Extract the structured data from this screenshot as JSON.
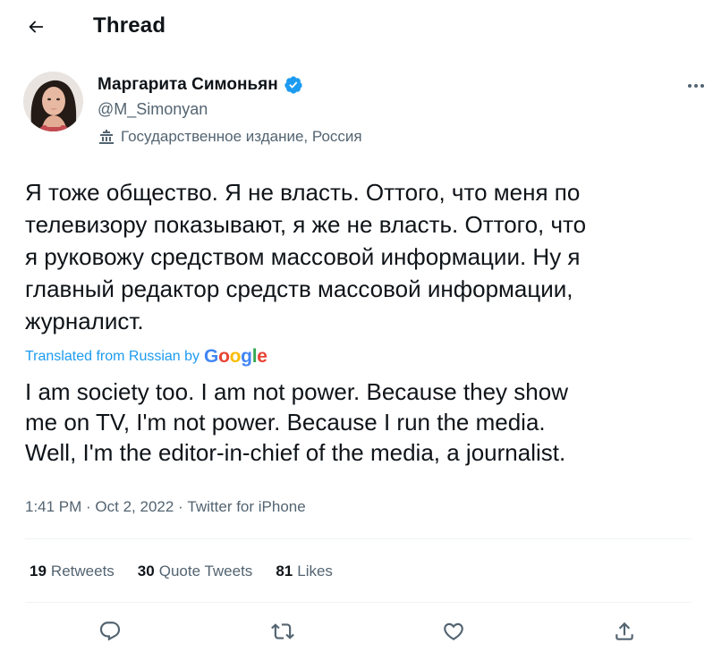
{
  "header": {
    "title": "Thread"
  },
  "author": {
    "name": "Маргарита Симоньян",
    "handle": "@M_Simonyan",
    "state_label": "Государственное издание, Россия"
  },
  "tweet": {
    "text": "Я тоже общество. Я не власть. Оттого, что меня по\nтелевизору показывают, я же не власть. Оттого, что\nя руковожу средством массовой информации. Ну я\nглавный редактор средств массовой информации,\nжурналист.",
    "translated_label": "Translated from Russian by",
    "translation_provider": "Google",
    "translation": "I am society too. I am not power. Because they show\nme on TV, I'm not power. Because I run the media.\nWell, I'm the editor-in-chief of the media, a journalist."
  },
  "meta": {
    "time": "1:41 PM",
    "separator": " · ",
    "date": "Oct 2, 2022",
    "source": "Twitter for iPhone"
  },
  "stats": {
    "retweets": {
      "count": "19",
      "label": "Retweets"
    },
    "quotes": {
      "count": "30",
      "label": "Quote Tweets"
    },
    "likes": {
      "count": "81",
      "label": "Likes"
    }
  },
  "icons": {
    "back": "arrow-left-icon",
    "verified": "verified-badge-icon",
    "state": "state-media-icon",
    "more": "more-dots-icon",
    "reply": "reply-icon",
    "retweet": "retweet-icon",
    "like": "heart-icon",
    "share": "share-icon"
  },
  "colors": {
    "text": "#0f1419",
    "secondary": "#536471",
    "accent": "#1d9bf0",
    "divider": "#eff3f4"
  }
}
